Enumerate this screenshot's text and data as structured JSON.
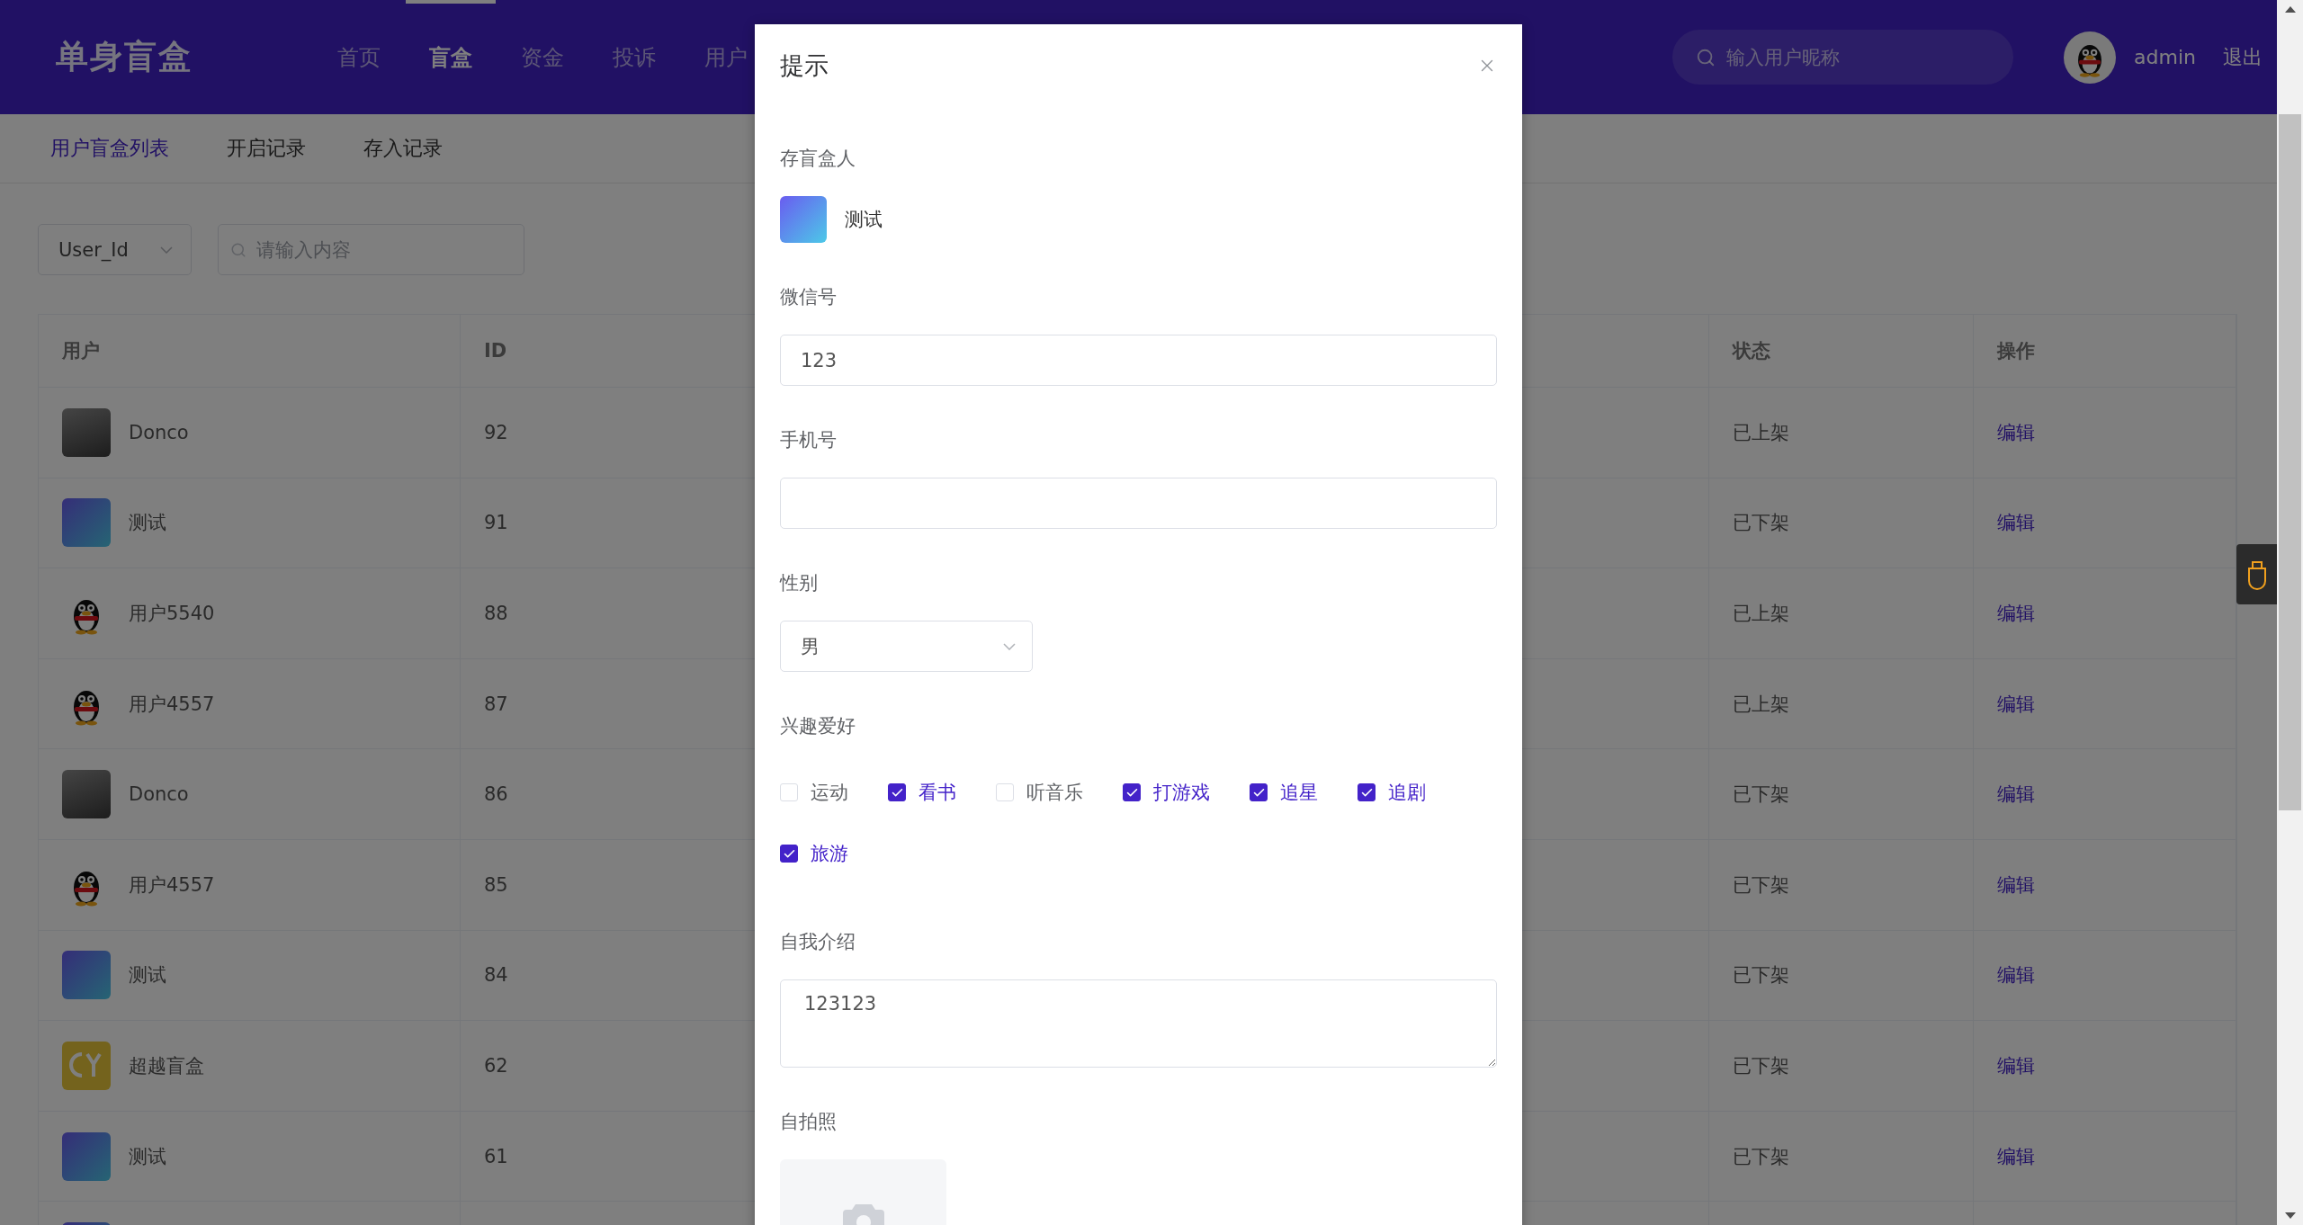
{
  "brand": {
    "logo": "单身盲盒"
  },
  "nav": [
    {
      "label": "首页",
      "selected": false
    },
    {
      "label": "盲盒",
      "selected": true
    },
    {
      "label": "资金",
      "selected": false
    },
    {
      "label": "投诉",
      "selected": false
    },
    {
      "label": "用户",
      "selected": false
    }
  ],
  "search": {
    "placeholder": "输入用户昵称"
  },
  "user": {
    "name": "admin",
    "logout": "退出"
  },
  "subnav": [
    {
      "label": "用户盲盒列表",
      "selected": true
    },
    {
      "label": "开启记录",
      "selected": false
    },
    {
      "label": "存入记录",
      "selected": false
    }
  ],
  "filter": {
    "field": "User_Id",
    "placeholder": "请输入内容"
  },
  "table": {
    "columns": [
      "用户",
      "ID",
      "状态",
      "操作"
    ],
    "rows": [
      {
        "avatar": {
          "kind": "photo"
        },
        "name": "Donco",
        "id": "92",
        "status": "已上架",
        "action": "编辑"
      },
      {
        "avatar": {
          "kind": "banner"
        },
        "name": "测试",
        "id": "91",
        "status": "已下架",
        "action": "编辑"
      },
      {
        "avatar": {
          "kind": "penguin"
        },
        "name": "用户5540",
        "id": "88",
        "status": "已上架",
        "action": "编辑"
      },
      {
        "avatar": {
          "kind": "penguin"
        },
        "name": "用户4557",
        "id": "87",
        "status": "已上架",
        "action": "编辑"
      },
      {
        "avatar": {
          "kind": "photo"
        },
        "name": "Donco",
        "id": "86",
        "status": "已下架",
        "action": "编辑"
      },
      {
        "avatar": {
          "kind": "penguin"
        },
        "name": "用户4557",
        "id": "85",
        "status": "已下架",
        "action": "编辑"
      },
      {
        "avatar": {
          "kind": "banner"
        },
        "name": "测试",
        "id": "84",
        "status": "已下架",
        "action": "编辑"
      },
      {
        "avatar": {
          "kind": "logo"
        },
        "name": "超越盲盒",
        "id": "62",
        "status": "已下架",
        "action": "编辑"
      },
      {
        "avatar": {
          "kind": "banner"
        },
        "name": "测试",
        "id": "61",
        "status": "已下架",
        "action": "编辑"
      },
      {
        "avatar": {
          "kind": "banner"
        }
      }
    ]
  },
  "dialog": {
    "title": "提示",
    "fields": [
      {
        "kind": "owner",
        "label": "存盲盒人",
        "avatar": {
          "kind": "banner"
        },
        "name": "测试"
      },
      {
        "kind": "input",
        "label": "微信号",
        "value": "123"
      },
      {
        "kind": "input",
        "label": "手机号"
      },
      {
        "kind": "select",
        "label": "性别",
        "value": "男"
      },
      {
        "kind": "checkboxes",
        "label": "兴趣爱好",
        "options": [
          {
            "label": "运动",
            "checked": false
          },
          {
            "label": "看书",
            "checked": true
          },
          {
            "label": "听音乐",
            "checked": false
          },
          {
            "label": "打游戏",
            "checked": true
          },
          {
            "label": "追星",
            "checked": true
          },
          {
            "label": "追剧",
            "checked": true
          },
          {
            "label": "旅游",
            "checked": true
          }
        ]
      },
      {
        "kind": "textarea",
        "label": "自我介绍",
        "value": "123123"
      },
      {
        "kind": "upload",
        "label": "自拍照"
      }
    ]
  }
}
